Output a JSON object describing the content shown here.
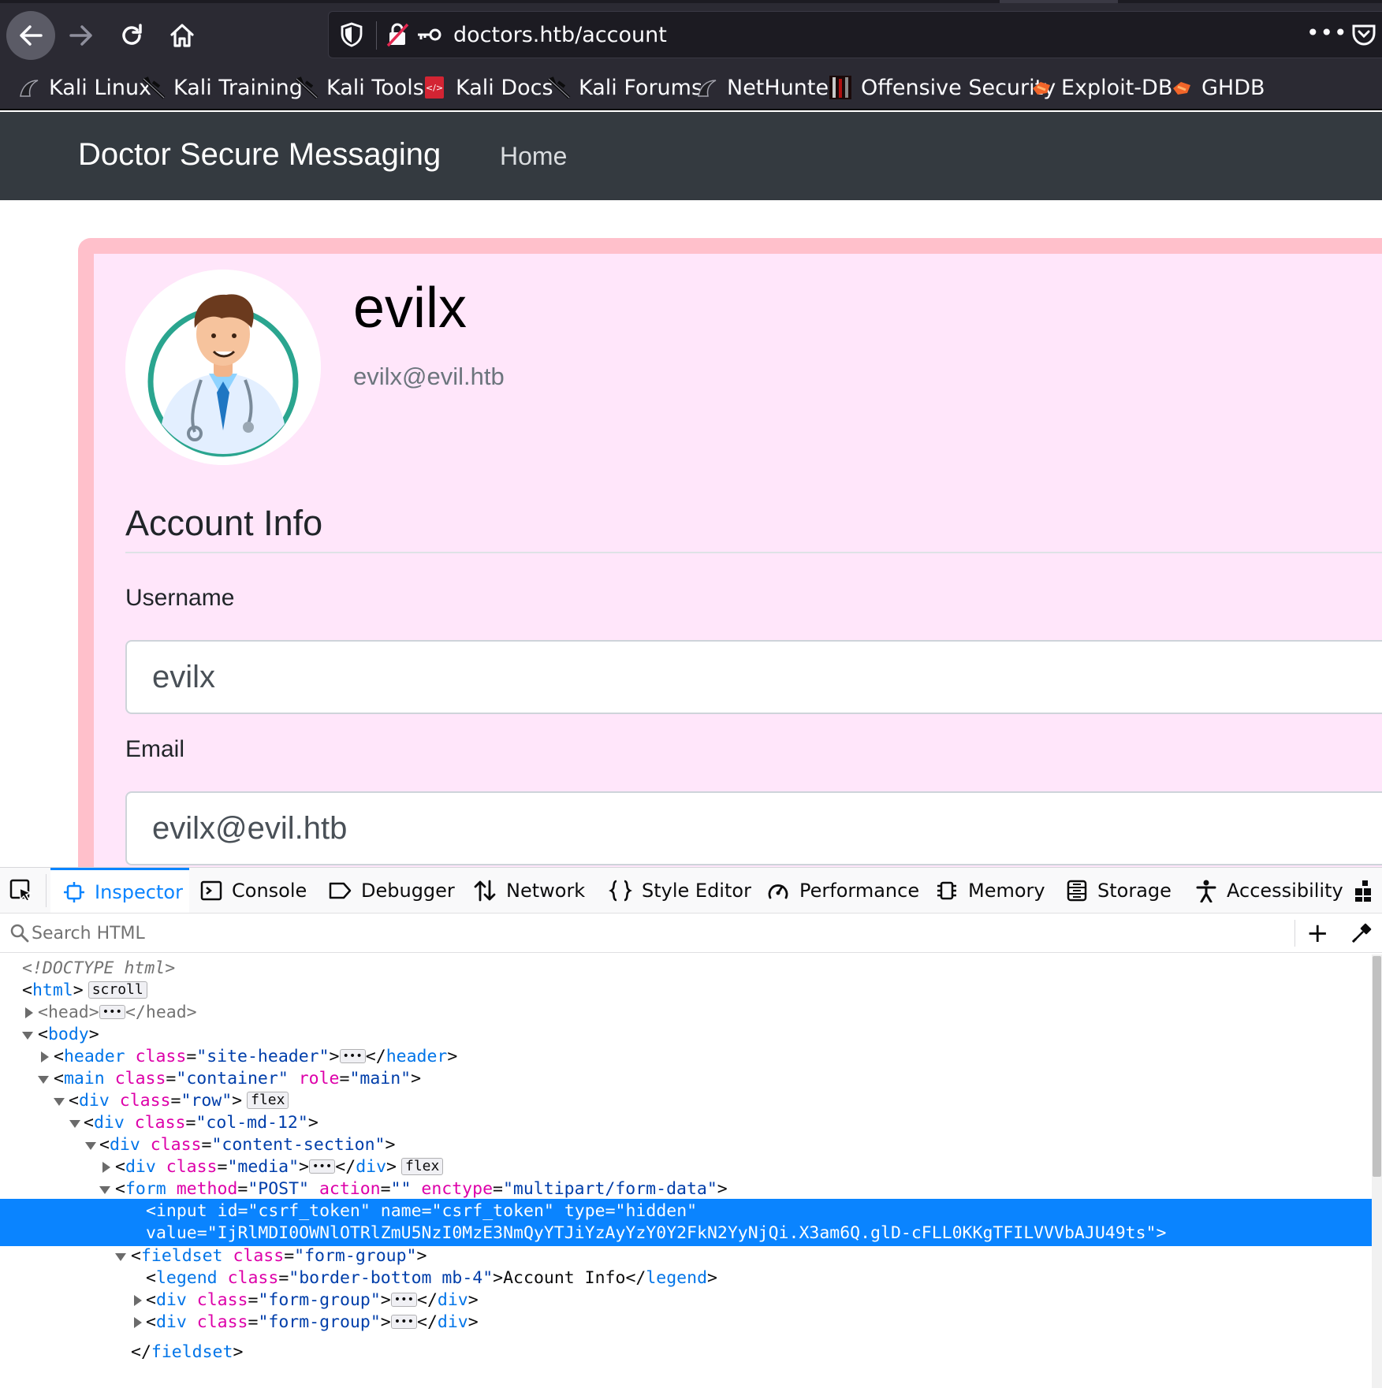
{
  "browser": {
    "url": "doctors.htb/account",
    "more_label": "•••",
    "bookmarks": [
      {
        "label": "Kali Linux",
        "icon": "kali-dragon-icon"
      },
      {
        "label": "Kali Training",
        "icon": "kali-dragon-icon"
      },
      {
        "label": "Kali Tools",
        "icon": "kali-dragon-icon"
      },
      {
        "label": "Kali Docs",
        "icon": "kali-docs-icon"
      },
      {
        "label": "Kali Forums",
        "icon": "kali-dragon-icon"
      },
      {
        "label": "NetHunter",
        "icon": "kali-dragon-icon"
      },
      {
        "label": "Offensive Security",
        "icon": "offsec-icon"
      },
      {
        "label": "Exploit-DB",
        "icon": "exploitdb-icon"
      },
      {
        "label": "GHDB",
        "icon": "exploitdb-icon"
      }
    ]
  },
  "site": {
    "brand": "Doctor Secure Messaging",
    "nav_home": "Home",
    "account": {
      "username_heading": "evilx",
      "email_sub": "evilx@evil.htb",
      "legend": "Account Info",
      "username_label": "Username",
      "username_value": "evilx",
      "email_label": "Email",
      "email_value": "evilx@evil.htb"
    }
  },
  "devtools": {
    "tabs": [
      {
        "label": "Inspector",
        "icon": "inspector-icon",
        "selected": true
      },
      {
        "label": "Console",
        "icon": "console-icon"
      },
      {
        "label": "Debugger",
        "icon": "debugger-icon"
      },
      {
        "label": "Network",
        "icon": "network-icon"
      },
      {
        "label": "Style Editor",
        "icon": "style-editor-icon"
      },
      {
        "label": "Performance",
        "icon": "performance-icon"
      },
      {
        "label": "Memory",
        "icon": "memory-icon"
      },
      {
        "label": "Storage",
        "icon": "storage-icon"
      },
      {
        "label": "Accessibility",
        "icon": "accessibility-icon"
      }
    ],
    "search_placeholder": "Search HTML",
    "add_label": "+",
    "badges": {
      "scroll": "scroll",
      "flex": "flex",
      "ellipsis": "•••"
    },
    "markup": {
      "doctype": "<!DOCTYPE html>",
      "html": "html",
      "head": "head",
      "body": "body",
      "header": "header",
      "main": "main",
      "div": "div",
      "form": "form",
      "input": "input",
      "fieldset": "fieldset",
      "legend_tag": "legend",
      "attr_class": "class",
      "attr_role": "role",
      "attr_method": "method",
      "attr_action": "action",
      "attr_enctype": "enctype",
      "attr_id": "id",
      "attr_name": "name",
      "attr_type": "type",
      "attr_value": "value",
      "val_site_header": "\"site-header\"",
      "val_container": "\"container\"",
      "val_main": "\"main\"",
      "val_row": "\"row\"",
      "val_col": "\"col-md-12\"",
      "val_content_section": "\"content-section\"",
      "val_media": "\"media\"",
      "val_post": "\"POST\"",
      "val_empty": "\"\"",
      "val_enctype": "\"multipart/form-data\"",
      "val_csrf": "\"csrf_token\"",
      "val_hidden": "\"hidden\"",
      "val_token": "\"IjRlMDI0OWNlOTRlZmU5NzI0MzE3NmQyYTJiYzAyYzY0Y2FkN2YyNjQi.X3am6Q.glD-cFLL0KKgTFILVVVbAJU49ts\"",
      "val_form_group": "\"form-group\"",
      "val_border_bottom": "\"border-bottom mb-4\"",
      "legend_text": "Account Info"
    }
  }
}
